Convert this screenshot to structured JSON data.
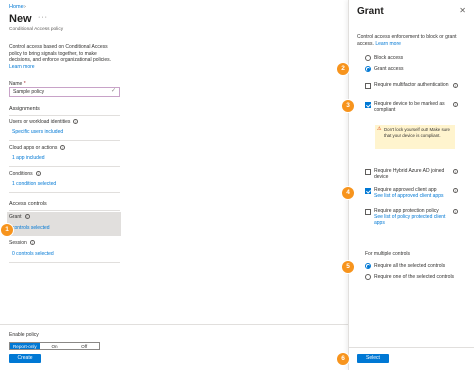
{
  "left": {
    "breadcrumb": "Home",
    "title": "New",
    "subtitle": "Conditional Access policy",
    "description": "Control access based on Conditional Access policy to bring signals together, to make decisions, and enforce organizational policies.",
    "learn_more": "Learn more",
    "name_label": "Name",
    "name_required": "*",
    "name_value": "Sample policy",
    "assignments": "Assignments",
    "users_label": "Users or workload identities",
    "users_value": "Specific users included",
    "apps_label": "Cloud apps or actions",
    "apps_value": "1 app included",
    "conditions_label": "Conditions",
    "conditions_value": "1 condition selected",
    "access_controls": "Access controls",
    "grant_label": "Grant",
    "grant_value": "controls selected",
    "session_label": "Session",
    "session_value": "0 controls selected",
    "enable_label": "Enable policy",
    "toggle": [
      "Report-only",
      "On",
      "Off"
    ],
    "create_label": "Create"
  },
  "right": {
    "title": "Grant",
    "close": "✕",
    "description": "Control access enforcement to block or grant access.",
    "learn_more": "Learn more",
    "block_access": "Block access",
    "grant_access": "Grant access",
    "require_mfa": "Require multifactor authentication",
    "require_compliant": "Require device to be marked as compliant",
    "warning": "Don't lock yourself out! Make sure that your device is compliant.",
    "require_hybrid": "Require Hybrid Azure AD joined device",
    "require_approved": "Require approved client app",
    "approved_link": "See list of approved client apps",
    "require_protection": "Require app protection policy",
    "protection_link": "See list of policy protected client apps",
    "multi_label": "For multiple controls",
    "require_all": "Require all the selected controls",
    "require_one": "Require one of the selected controls",
    "select_label": "Select"
  },
  "steps": [
    "1",
    "2",
    "3",
    "4",
    "5",
    "6"
  ],
  "colors": {
    "accent": "#0078d4",
    "step": "#f7941d",
    "warning_bg": "#fff4ce"
  }
}
